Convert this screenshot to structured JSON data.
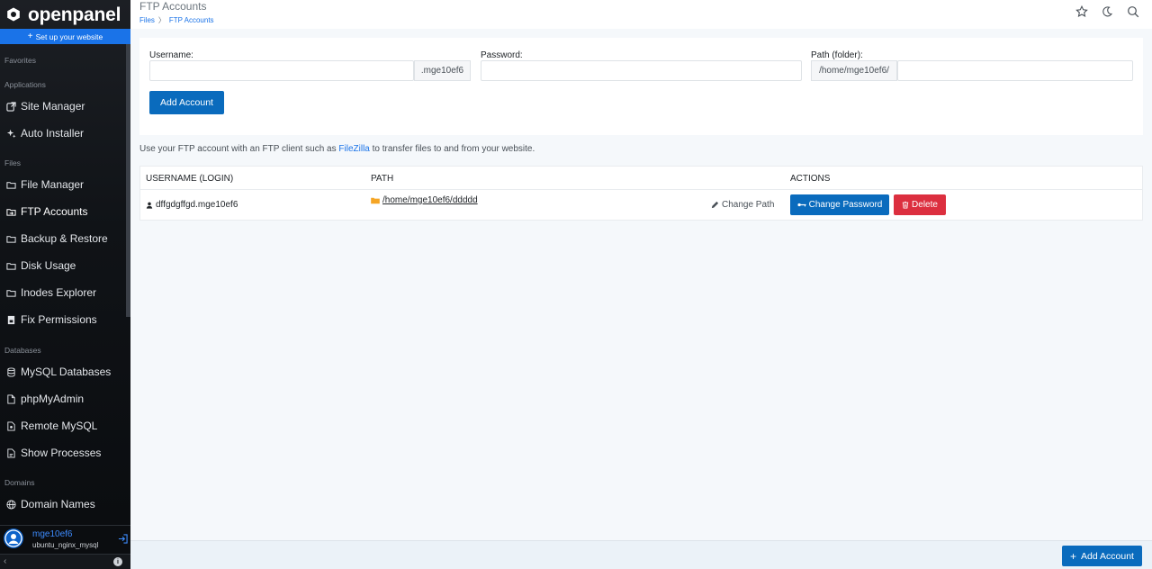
{
  "brand": {
    "name": "openpanel"
  },
  "sidebar": {
    "setup_label": "Set up your website",
    "sections": {
      "favorites": "Favorites",
      "applications": "Applications",
      "files": "Files",
      "databases": "Databases",
      "domains": "Domains"
    },
    "items": [
      {
        "label": "Site Manager",
        "icon": "external-link-icon"
      },
      {
        "label": "Auto Installer",
        "icon": "sparkle-icon"
      },
      {
        "label": "File Manager",
        "icon": "folder-icon"
      },
      {
        "label": "FTP Accounts",
        "icon": "ftp-folder-icon"
      },
      {
        "label": "Backup & Restore",
        "icon": "folder-icon"
      },
      {
        "label": "Disk Usage",
        "icon": "folder-icon"
      },
      {
        "label": "Inodes Explorer",
        "icon": "folder-icon"
      },
      {
        "label": "Fix Permissions",
        "icon": "permissions-icon"
      },
      {
        "label": "MySQL Databases",
        "icon": "database-icon"
      },
      {
        "label": "phpMyAdmin",
        "icon": "phpmyadmin-icon"
      },
      {
        "label": "Remote MySQL",
        "icon": "remote-db-icon"
      },
      {
        "label": "Show Processes",
        "icon": "processes-icon"
      },
      {
        "label": "Domain Names",
        "icon": "globe-icon"
      }
    ],
    "active_item": "FTP Accounts",
    "user": {
      "name": "mge10ef6",
      "server": "ubuntu_nginx_mysql"
    }
  },
  "header": {
    "title": "FTP Accounts",
    "breadcrumb": [
      "Files",
      "FTP Accounts"
    ]
  },
  "form": {
    "username_label": "Username:",
    "username_value": "",
    "username_suffix": ".mge10ef6",
    "password_label": "Password:",
    "password_value": "",
    "path_label": "Path (folder):",
    "path_prefix": "/home/mge10ef6/",
    "path_value": "",
    "submit_label": "Add Account"
  },
  "helper": {
    "before": "Use your FTP account with an FTP client such as ",
    "link": "FileZilla",
    "after": " to transfer files to and from your website."
  },
  "table": {
    "columns": [
      "USERNAME (LOGIN)",
      "PATH",
      "ACTIONS"
    ],
    "rows": [
      {
        "username": "dffgdgffgd.mge10ef6",
        "path": "/home/mge10ef6/ddddd",
        "change_path": "Change Path",
        "change_password": "Change Password",
        "delete": "Delete"
      }
    ]
  },
  "footer": {
    "add_label": "Add Account"
  },
  "colors": {
    "primary": "#0a6bbd",
    "danger": "#dc2f3f",
    "link": "#1a73e8",
    "folder": "#f5a524"
  }
}
